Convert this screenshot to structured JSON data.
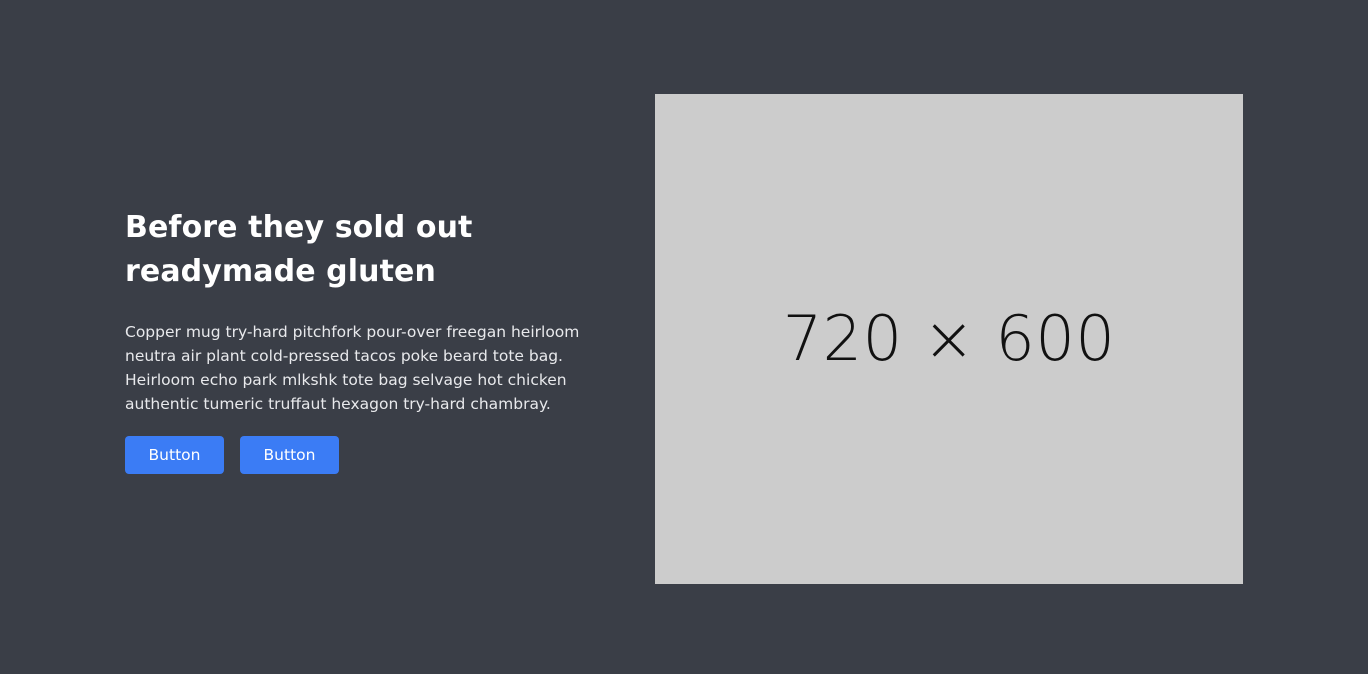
{
  "hero": {
    "heading_line1": "Before they sold out",
    "heading_line2": "readymade gluten",
    "paragraph_lines": [
      "Copper mug try-hard pitchfork pour-over freegan heirloom",
      "neutra air plant cold-pressed tacos poke beard tote bag.",
      "Heirloom echo park mlkshk tote bag selvage hot chicken",
      "authentic tumeric truffaut hexagon try-hard chambray."
    ],
    "buttons": [
      {
        "label": "Button"
      },
      {
        "label": "Button"
      }
    ],
    "image_placeholder_label": "720 × 600"
  },
  "colors": {
    "background": "#3a3e47",
    "button": "#3b7cf5",
    "placeholder": "#cccccc"
  }
}
